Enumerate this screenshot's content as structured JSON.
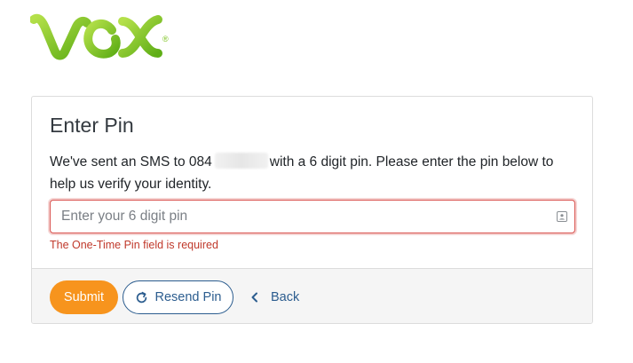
{
  "brand": {
    "logo_text": "VOX",
    "registered_mark": "®",
    "accent_green": "#7cc21f",
    "accent_orange": "#f7941d",
    "accent_blue": "#2c5d8f"
  },
  "card": {
    "title": "Enter Pin",
    "message_before": "We've sent an SMS to 084",
    "message_after": "with a 6 digit pin. Please enter the pin below to help us verify your identity.",
    "pin_input": {
      "value": "",
      "placeholder": "Enter your 6 digit pin"
    },
    "error_text": "The One-Time Pin field is required"
  },
  "footer": {
    "submit_label": "Submit",
    "resend_label": "Resend Pin",
    "back_label": "Back"
  },
  "icons": {
    "input_trailing": "autofill-card-icon",
    "resend": "refresh-icon",
    "back": "chevron-left-icon"
  }
}
